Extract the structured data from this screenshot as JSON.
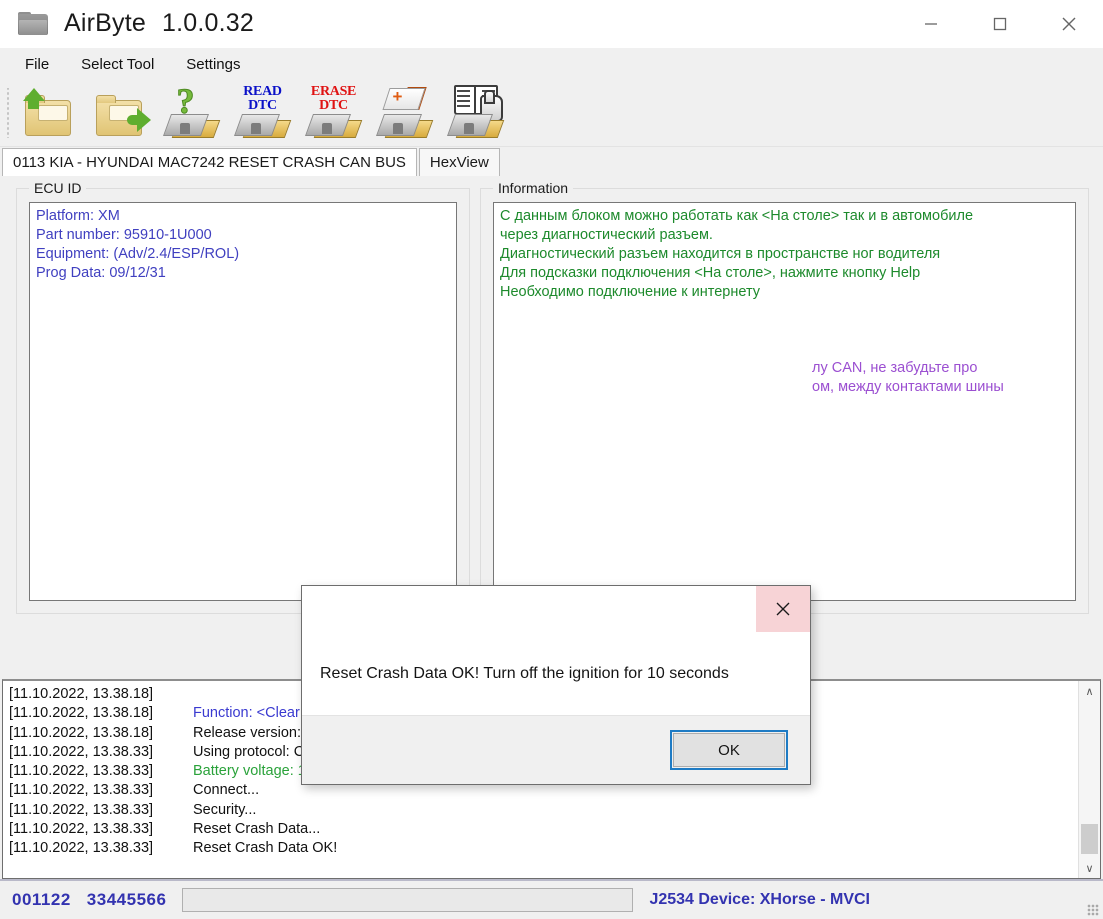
{
  "window": {
    "title_app": "AirByte",
    "title_version": "1.0.0.32",
    "minimize_label": "—",
    "maximize_label": "□",
    "close_label": "✕"
  },
  "menu": {
    "items": [
      {
        "label": "File"
      },
      {
        "label": "Select Tool"
      },
      {
        "label": "Settings"
      }
    ]
  },
  "toolbar": {
    "buttons": [
      {
        "name": "open-file-icon",
        "tooltip": "Open file"
      },
      {
        "name": "save-file-icon",
        "tooltip": "Save file"
      },
      {
        "name": "identify-ecu-icon",
        "tooltip": "Identify ECU"
      },
      {
        "name": "read-dtc-icon",
        "line1": "READ",
        "line2": "DTC"
      },
      {
        "name": "erase-dtc-icon",
        "line1": "ERASE",
        "line2": "DTC"
      },
      {
        "name": "clear-crash-icon",
        "tooltip": "Clear crash"
      },
      {
        "name": "help-icon",
        "tooltip": "Help"
      }
    ]
  },
  "tabs": [
    {
      "label": "0113 KIA - HYUNDAI MAC7242 RESET CRASH CAN BUS",
      "active": true
    },
    {
      "label": "HexView",
      "active": false
    }
  ],
  "ecu_id": {
    "group_title": "ECU ID",
    "lines": [
      "Platform: XM",
      "Part number: 95910-1U000",
      "Equipment: (Adv/2.4/ESP/ROL)",
      "Prog Data: 09/12/31"
    ],
    "text_color": "#4040c0"
  },
  "information": {
    "group_title": "Information",
    "green_color": "#1d8a2c",
    "purple_color": "#9b4fd1",
    "green_lines": [
      "С данным блоком можно работать как <На столе> так и в автомобиле",
      "через диагностический разъем.",
      "Диагностический разъем находится в пространстве ног водителя",
      "Для подсказки подключения <На столе>, нажмите кнопку Help",
      "Необходимо подключение к интернету"
    ],
    "purple_lines": [
      "лу CAN, не забудьте про",
      "ом, между контактами шины"
    ]
  },
  "log": {
    "rows": [
      {
        "ts": "[11.10.2022, 13.38.18]",
        "msg": "",
        "color": "normal"
      },
      {
        "ts": "[11.10.2022, 13.38.18]",
        "msg": "Function: <Clear Crash>",
        "color": "blue"
      },
      {
        "ts": "[11.10.2022, 13.38.18]",
        "msg": "Release version: 1.0.0.32",
        "color": "normal"
      },
      {
        "ts": "[11.10.2022, 13.38.33]",
        "msg": "Using protocol: CAN",
        "color": "normal"
      },
      {
        "ts": "[11.10.2022, 13.38.33]",
        "msg": "Battery voltage: 12,0V",
        "color": "green"
      },
      {
        "ts": "[11.10.2022, 13.38.33]",
        "msg": "Connect...",
        "color": "normal"
      },
      {
        "ts": "[11.10.2022, 13.38.33]",
        "msg": "Security...",
        "color": "normal"
      },
      {
        "ts": "[11.10.2022, 13.38.33]",
        "msg": "Reset Crash Data...",
        "color": "normal"
      },
      {
        "ts": "[11.10.2022, 13.38.33]",
        "msg": "Reset Crash Data OK!",
        "color": "normal"
      }
    ],
    "scroll_up_icon": "∧",
    "scroll_down_icon": "∨"
  },
  "statusbar": {
    "code_left": "001122",
    "code_right": "33445566",
    "device": "J2534 Device: XHorse - MVCI",
    "accent_color": "#3333b0"
  },
  "dialog": {
    "message": "Reset Crash Data OK! Turn off the ignition for 10 seconds",
    "ok_label": "OK",
    "close_label": "✕"
  }
}
